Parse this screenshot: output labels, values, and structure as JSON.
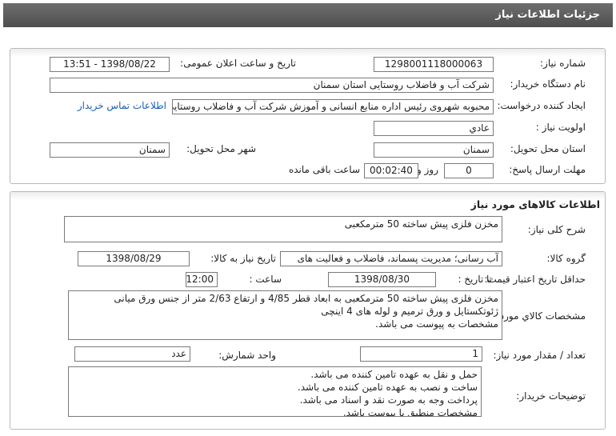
{
  "window_title": "جزئیات اطلاعات نیاز",
  "general": {
    "need_number_label": "شماره نیاز:",
    "need_number": "1298001118000063",
    "announce_datetime_label": "تاریخ و ساعت اعلان عمومی:",
    "announce_datetime": "1398/08/22 - 13:51",
    "buyer_org_label": "نام دستگاه خریدار:",
    "buyer_org": "شرکت آب و فاضلاب روستایی استان سمنان",
    "requester_label": "ایجاد کننده درخواست:",
    "requester": "محبوبه شهروی رئیس اداره منابع انسانی و آموزش شرکت آب و فاضلاب روستایی",
    "buyer_contact_link": "اطلاعات تماس خریدار",
    "priority_label": "اولویت نیاز :",
    "priority": "عادي",
    "delivery_province_label": "استان محل تحویل:",
    "delivery_province": "سمنان",
    "delivery_city_label": "شهر محل تحویل:",
    "delivery_city": "سمنان",
    "deadline_label": "مهلت ارسال پاسخ:",
    "deadline_days": "0",
    "days_and_label": "روز و",
    "deadline_time": "00:02:40",
    "remaining_label": "ساعت باقی مانده"
  },
  "goods": {
    "section_title": "اطلاعات کالاهای مورد نیاز",
    "summary_label": "شرح کلی نیاز:",
    "summary": "مخزن فلزی پیش ساخته 50 مترمکعبی",
    "group_label": "گروه کالا:",
    "group": "آب رسانی؛ مدیریت پسماند، فاضلاب و فعالیت های",
    "need_date_label": "تاریخ نیاز به کالا:",
    "need_date": "1398/08/29",
    "min_validity_label": "حداقل تاریخ اعتبار قیمت:",
    "until_date_label": "تا تاریخ :",
    "until_date": "1398/08/30",
    "time_label": "ساعت :",
    "time": "12:00",
    "specs_label": "مشخصات کالاي مورد نياز:",
    "specs_lines": [
      "مخزن فلزی پیش ساخته 50 مترمکعبی به ابعاد قطر 4/85 و ارتفاع 2/63 متر از جنس ورق میانی",
      "ژئوتکستایل و ورق ترمیم و لوله های 4 اینچی",
      "مشخصات به پیوست می باشد."
    ],
    "qty_label": "تعداد / مقدار مورد نیاز:",
    "qty": "1",
    "unit_label": "واحد شمارش:",
    "unit": "عدد",
    "buyer_notes_label": "توضیحات خریدار:",
    "buyer_notes_lines": [
      "حمل و نقل به عهده تامین کننده می باشد.",
      "ساخت و نصب به عهده تامین کننده می باشد.",
      "پرداخت وجه به صورت نقد و اسناد می باشد.",
      "مشخصات منطبق با پیوست باشد."
    ]
  }
}
